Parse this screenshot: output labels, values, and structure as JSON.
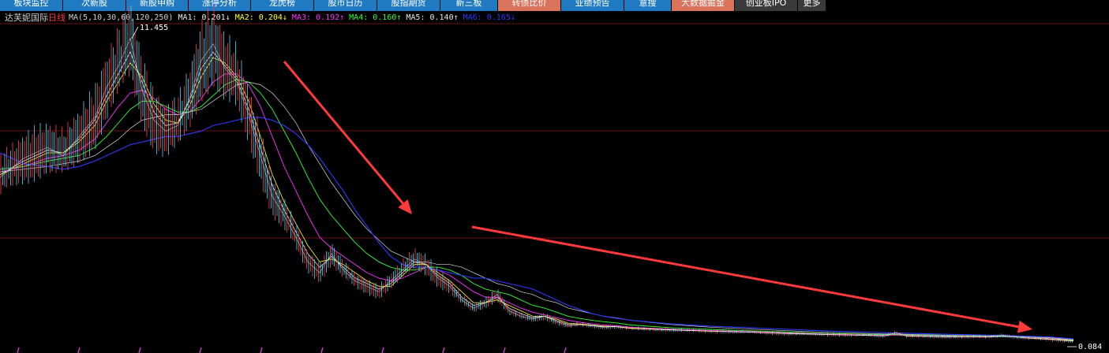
{
  "tabs": [
    {
      "label": "板块监控",
      "style": "blue"
    },
    {
      "label": "次新股",
      "style": "blue"
    },
    {
      "label": "新股申购",
      "style": "blue"
    },
    {
      "label": "涨停分析",
      "style": "blue"
    },
    {
      "label": "龙虎榜",
      "style": "blue"
    },
    {
      "label": "股市日历",
      "style": "blue"
    },
    {
      "label": "股指期货",
      "style": "blue"
    },
    {
      "label": "新三板",
      "style": "blue"
    },
    {
      "label": "转债比价",
      "style": "orange"
    },
    {
      "label": "业绩预告",
      "style": "blue"
    },
    {
      "label": "意搜",
      "style": "blue"
    },
    {
      "label": "大数据掘金",
      "style": "orange"
    },
    {
      "label": "创业板IPO",
      "style": "gray"
    },
    {
      "label": "更多",
      "style": "gray"
    }
  ],
  "legend": {
    "stock_name": "达芙妮国际",
    "period": "日线",
    "ma_params": "MA(5,10,30,60,120,250)",
    "items": [
      {
        "text": "MA1: 0.201",
        "arrow": "↓",
        "color": "#e8e8e8"
      },
      {
        "text": "MA2: 0.204",
        "arrow": "↓",
        "color": "#ffff33"
      },
      {
        "text": "MA3: 0.192",
        "arrow": "↑",
        "color": "#ff33ff"
      },
      {
        "text": "MA4: 0.160",
        "arrow": "↑",
        "color": "#33ff33"
      },
      {
        "text": "MA5: 0.140",
        "arrow": "↑",
        "color": "#e8e8e8"
      },
      {
        "text": "MA6: 0.165",
        "arrow": "↓",
        "color": "#2a3cff"
      }
    ]
  },
  "chart_data": {
    "type": "line",
    "x": [
      0,
      30,
      60,
      80,
      100,
      120,
      135,
      150,
      165,
      180,
      195,
      210,
      225,
      240,
      255,
      270,
      285,
      300,
      315,
      330,
      345,
      360,
      375,
      390,
      405,
      420,
      435,
      450,
      465,
      480,
      495,
      510,
      525,
      540,
      555,
      570,
      585,
      600,
      615,
      630,
      645,
      660,
      675,
      690,
      705,
      720,
      735,
      750,
      765,
      780,
      800,
      850,
      900,
      950,
      1000,
      1050,
      1100,
      1120,
      1135,
      1150,
      1200,
      1250,
      1270,
      1280,
      1300,
      1330,
      1360
    ],
    "series": [
      {
        "name": "Price",
        "values": [
          6.1,
          6.8,
          7.2,
          6.9,
          7.6,
          8.3,
          9.4,
          10.2,
          11.2,
          9.3,
          8.2,
          7.8,
          8.0,
          9.0,
          10.4,
          11.0,
          10.1,
          9.6,
          8.4,
          6.9,
          5.4,
          4.7,
          3.9,
          3.0,
          2.6,
          3.3,
          2.7,
          2.3,
          2.1,
          1.9,
          2.3,
          2.7,
          3.1,
          2.9,
          2.4,
          2.1,
          1.6,
          1.3,
          1.5,
          1.8,
          1.2,
          1.0,
          0.9,
          1.0,
          0.8,
          0.65,
          0.7,
          0.65,
          0.6,
          0.62,
          0.55,
          0.5,
          0.45,
          0.42,
          0.36,
          0.33,
          0.3,
          0.28,
          0.4,
          0.27,
          0.25,
          0.24,
          0.3,
          0.26,
          0.2,
          0.15,
          0.084
        ]
      },
      {
        "name": "MA1",
        "values": [
          6.2,
          6.7,
          7.1,
          7.0,
          7.5,
          8.2,
          9.1,
          9.9,
          10.7,
          9.6,
          8.5,
          8.0,
          8.1,
          8.9,
          10.1,
          10.7,
          10.2,
          9.7,
          8.6,
          7.2,
          5.8,
          4.9,
          4.1,
          3.3,
          2.8,
          3.2,
          2.8,
          2.4,
          2.2,
          2.0,
          2.2,
          2.6,
          3.0,
          2.9,
          2.5,
          2.2,
          1.7,
          1.4,
          1.5,
          1.7,
          1.3,
          1.1,
          0.95,
          1.0,
          0.85,
          0.7,
          0.7,
          0.66,
          0.62,
          0.62,
          0.56,
          0.5,
          0.46,
          0.42,
          0.37,
          0.33,
          0.3,
          0.29,
          0.35,
          0.28,
          0.25,
          0.24,
          0.28,
          0.26,
          0.21,
          0.16,
          0.1
        ]
      },
      {
        "name": "MA2",
        "values": [
          6.2,
          6.6,
          7.0,
          7.0,
          7.4,
          8.0,
          8.9,
          9.6,
          10.3,
          9.8,
          8.8,
          8.2,
          8.1,
          8.7,
          9.8,
          10.5,
          10.3,
          9.8,
          8.9,
          7.6,
          6.2,
          5.2,
          4.4,
          3.6,
          3.0,
          3.1,
          2.9,
          2.6,
          2.3,
          2.1,
          2.1,
          2.5,
          2.9,
          2.9,
          2.6,
          2.3,
          1.9,
          1.5,
          1.5,
          1.6,
          1.4,
          1.2,
          1.0,
          1.0,
          0.9,
          0.75,
          0.72,
          0.68,
          0.64,
          0.62,
          0.57,
          0.51,
          0.46,
          0.43,
          0.38,
          0.34,
          0.31,
          0.3,
          0.32,
          0.29,
          0.26,
          0.24,
          0.26,
          0.26,
          0.22,
          0.17,
          0.12
        ]
      },
      {
        "name": "MA3",
        "values": [
          6.3,
          6.5,
          6.8,
          6.9,
          7.1,
          7.5,
          8.1,
          8.7,
          9.2,
          9.3,
          9.0,
          8.6,
          8.4,
          8.5,
          9.0,
          9.6,
          9.9,
          9.9,
          9.5,
          8.7,
          7.6,
          6.5,
          5.6,
          4.7,
          3.9,
          3.5,
          3.2,
          2.9,
          2.6,
          2.4,
          2.3,
          2.4,
          2.6,
          2.8,
          2.7,
          2.5,
          2.2,
          1.9,
          1.7,
          1.7,
          1.5,
          1.3,
          1.15,
          1.05,
          0.95,
          0.85,
          0.78,
          0.72,
          0.68,
          0.65,
          0.6,
          0.53,
          0.48,
          0.44,
          0.39,
          0.35,
          0.32,
          0.31,
          0.31,
          0.3,
          0.27,
          0.25,
          0.25,
          0.25,
          0.23,
          0.19,
          0.15
        ]
      },
      {
        "name": "MA4",
        "values": [
          6.4,
          6.5,
          6.7,
          6.8,
          6.9,
          7.2,
          7.6,
          8.1,
          8.6,
          8.9,
          8.9,
          8.7,
          8.5,
          8.5,
          8.7,
          9.1,
          9.5,
          9.7,
          9.6,
          9.2,
          8.6,
          7.8,
          7.0,
          6.1,
          5.3,
          4.7,
          4.2,
          3.7,
          3.3,
          3.0,
          2.8,
          2.7,
          2.7,
          2.8,
          2.8,
          2.7,
          2.5,
          2.2,
          2.0,
          1.9,
          1.8,
          1.6,
          1.4,
          1.3,
          1.15,
          1.0,
          0.92,
          0.85,
          0.8,
          0.76,
          0.68,
          0.58,
          0.52,
          0.47,
          0.42,
          0.37,
          0.34,
          0.33,
          0.33,
          0.32,
          0.29,
          0.27,
          0.26,
          0.26,
          0.24,
          0.21,
          0.16
        ]
      },
      {
        "name": "MA5",
        "values": [
          6.3,
          6.4,
          6.5,
          6.6,
          6.7,
          6.9,
          7.2,
          7.5,
          7.9,
          8.2,
          8.3,
          8.4,
          8.4,
          8.5,
          8.6,
          8.9,
          9.2,
          9.5,
          9.6,
          9.5,
          9.2,
          8.7,
          8.1,
          7.3,
          6.6,
          5.9,
          5.3,
          4.7,
          4.2,
          3.8,
          3.4,
          3.2,
          3.0,
          3.0,
          2.9,
          2.9,
          2.8,
          2.6,
          2.4,
          2.2,
          2.1,
          1.9,
          1.8,
          1.6,
          1.5,
          1.3,
          1.2,
          1.1,
          1.0,
          0.95,
          0.85,
          0.7,
          0.6,
          0.53,
          0.47,
          0.41,
          0.37,
          0.35,
          0.35,
          0.34,
          0.31,
          0.29,
          0.28,
          0.27,
          0.25,
          0.22,
          0.14
        ]
      },
      {
        "name": "MA6",
        "values": [
          7.0,
          6.6,
          6.5,
          6.4,
          6.5,
          6.7,
          6.9,
          7.1,
          7.3,
          7.4,
          7.5,
          7.6,
          7.6,
          7.7,
          7.8,
          8.0,
          8.1,
          8.2,
          8.3,
          8.3,
          8.2,
          8.0,
          7.7,
          7.3,
          6.8,
          6.2,
          5.6,
          4.9,
          4.3,
          3.7,
          3.2,
          2.9,
          2.8,
          2.8,
          2.7,
          2.6,
          2.5,
          2.4,
          2.4,
          2.3,
          2.2,
          2.1,
          2.0,
          1.8,
          1.6,
          1.4,
          1.25,
          1.1,
          1.0,
          0.93,
          0.85,
          0.72,
          0.64,
          0.58,
          0.52,
          0.46,
          0.42,
          0.4,
          0.39,
          0.38,
          0.34,
          0.31,
          0.3,
          0.29,
          0.27,
          0.24,
          0.17
        ]
      }
    ],
    "ylim": [
      0,
      11.455
    ],
    "grid": true,
    "annotations": {
      "high_label": "11.455",
      "low_label": "0.084"
    }
  }
}
